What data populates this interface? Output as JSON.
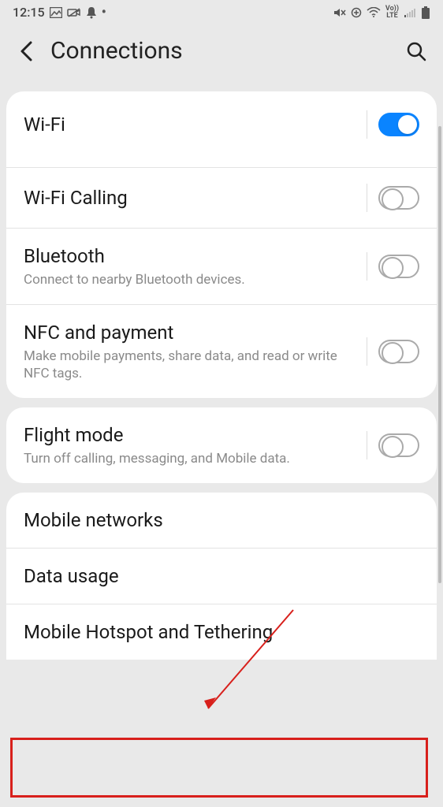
{
  "status": {
    "time": "12:15",
    "left_icons": [
      "🖼",
      "📷",
      "🔔",
      "•"
    ],
    "right_icons": [
      "🔇",
      "⬢",
      "📶",
      "LTE",
      "📶",
      "🔋"
    ]
  },
  "header": {
    "title": "Connections"
  },
  "group1": {
    "wifi": {
      "title": "Wi-Fi",
      "on": true
    },
    "wifi_calling": {
      "title": "Wi-Fi Calling",
      "on": false
    },
    "bluetooth": {
      "title": "Bluetooth",
      "sub": "Connect to nearby Bluetooth devices.",
      "on": false
    },
    "nfc": {
      "title": "NFC and payment",
      "sub": "Make mobile payments, share data, and read or write NFC tags.",
      "on": false
    }
  },
  "group2": {
    "flight": {
      "title": "Flight mode",
      "sub": "Turn off calling, messaging, and Mobile data.",
      "on": false
    }
  },
  "group3": {
    "mobile_networks": {
      "title": "Mobile networks"
    },
    "data_usage": {
      "title": "Data usage"
    },
    "hotspot": {
      "title": "Mobile Hotspot and Tethering"
    }
  }
}
